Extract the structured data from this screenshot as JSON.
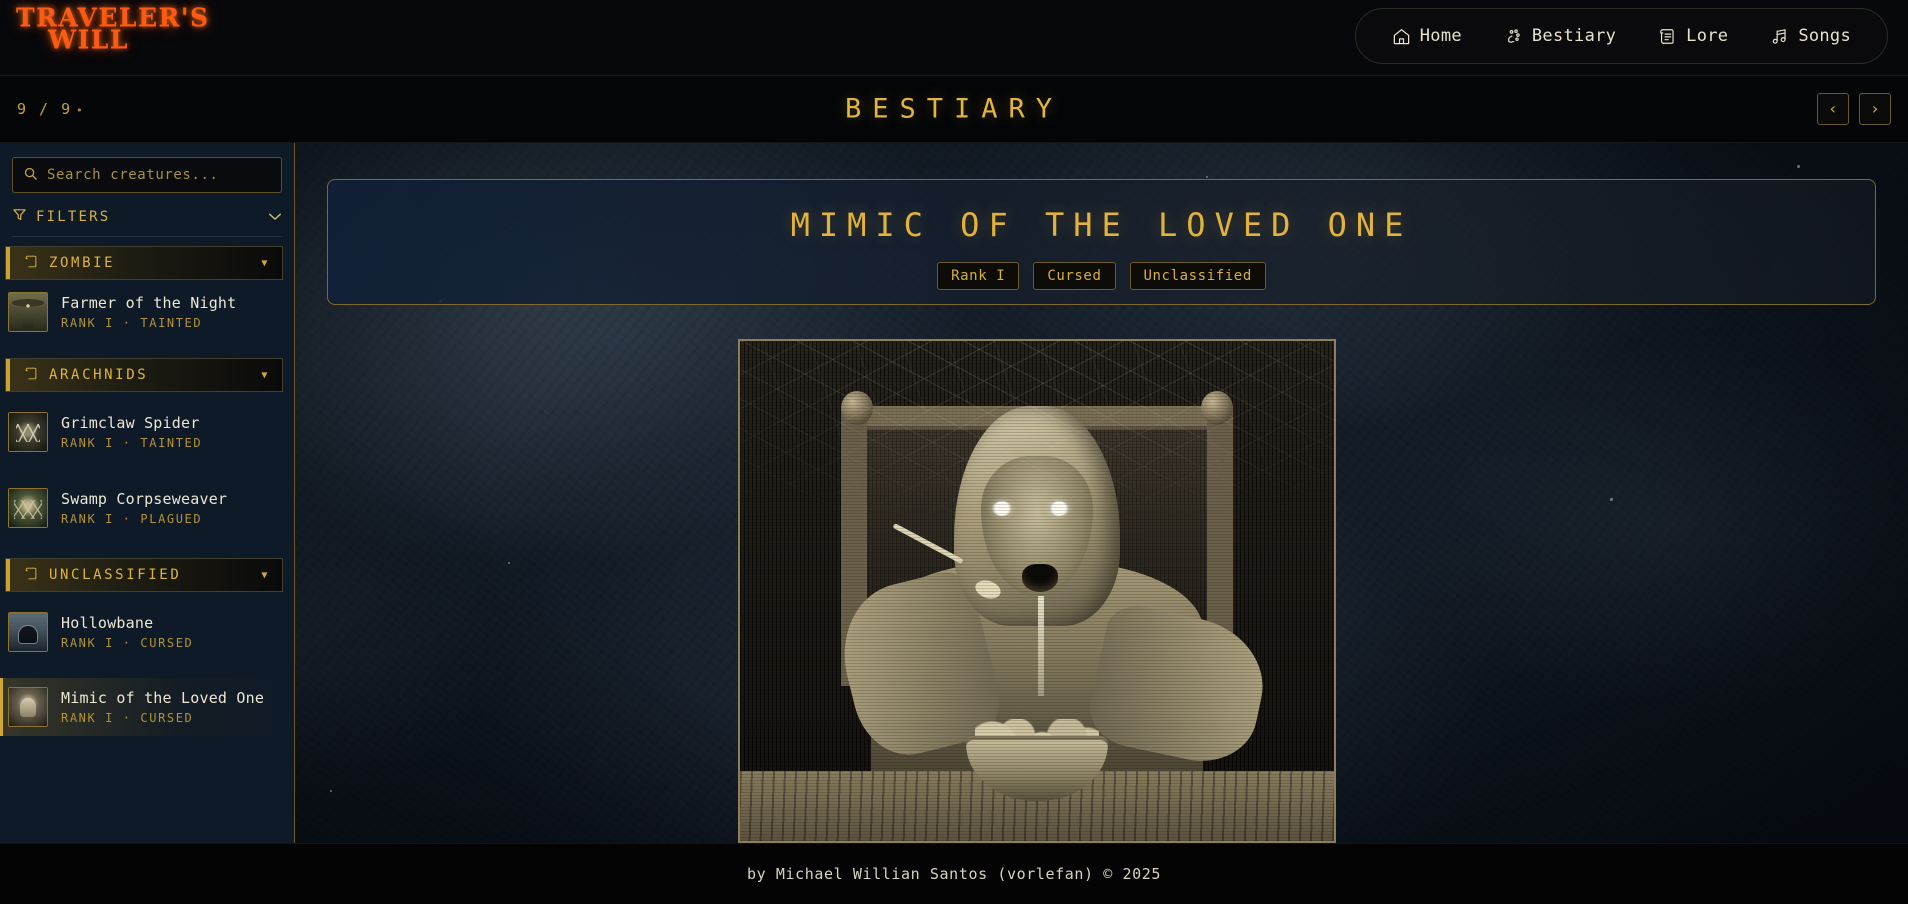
{
  "brand": {
    "line1": "TRAVELER'S",
    "line2": "WILL",
    "accent": "#ff5a14"
  },
  "nav": {
    "items": [
      {
        "label": "Home",
        "icon": "home-icon"
      },
      {
        "label": "Bestiary",
        "icon": "paw-icon"
      },
      {
        "label": "Lore",
        "icon": "scroll-icon"
      },
      {
        "label": "Songs",
        "icon": "music-note-icon"
      }
    ]
  },
  "page_header": {
    "counter": "9 / 9",
    "counter_dot": "•",
    "title": "BESTIARY",
    "prev_label": "‹",
    "next_label": "›",
    "accent": "#e2b63c"
  },
  "sidebar": {
    "search": {
      "placeholder": "Search creatures...",
      "value": "",
      "icon": "search-icon"
    },
    "filters": {
      "label": "FILTERS",
      "icon": "funnel-icon",
      "chevron": "⌄"
    },
    "categories": [
      {
        "name": "ZOMBIE",
        "icon": "scroll-icon",
        "caret": "▼",
        "creatures": [
          {
            "name": "Farmer of the Night",
            "meta": "RANK I · TAINTED",
            "art": "art-farmer",
            "selected": false
          }
        ]
      },
      {
        "name": "ARACHNIDS",
        "icon": "scroll-icon",
        "caret": "▼",
        "creatures": [
          {
            "name": "Grimclaw Spider",
            "meta": "RANK I · TAINTED",
            "art": "art-grim",
            "selected": false
          },
          {
            "name": "Swamp Corpseweaver",
            "meta": "RANK I · PLAGUED",
            "art": "art-swamp",
            "selected": false
          }
        ]
      },
      {
        "name": "UNCLASSIFIED",
        "icon": "scroll-icon",
        "caret": "▼",
        "creatures": [
          {
            "name": "Hollowbane",
            "meta": "RANK I · CURSED",
            "art": "art-hollow",
            "selected": false
          },
          {
            "name": "Mimic of the Loved One",
            "meta": "RANK I · CURSED",
            "art": "art-mimic",
            "selected": true
          }
        ]
      }
    ]
  },
  "detail": {
    "title": "MIMIC OF THE LOVED ONE",
    "badges": [
      "Rank I",
      "Cursed",
      "Unclassified"
    ],
    "artwork_alt": "Hooded emaciated figure eating grubs from a bowl at a cobwebbed table"
  },
  "footer": {
    "text": "by Michael Willian Santos (vorlefan) © 2025"
  },
  "colors": {
    "gold": "#e2b63c",
    "gold_dim": "#b29234",
    "border_gold": "#6b5a24",
    "bg_dark": "#05060a",
    "sidebar_bg": "#0e1a28",
    "parchment": "#ece6d4"
  }
}
